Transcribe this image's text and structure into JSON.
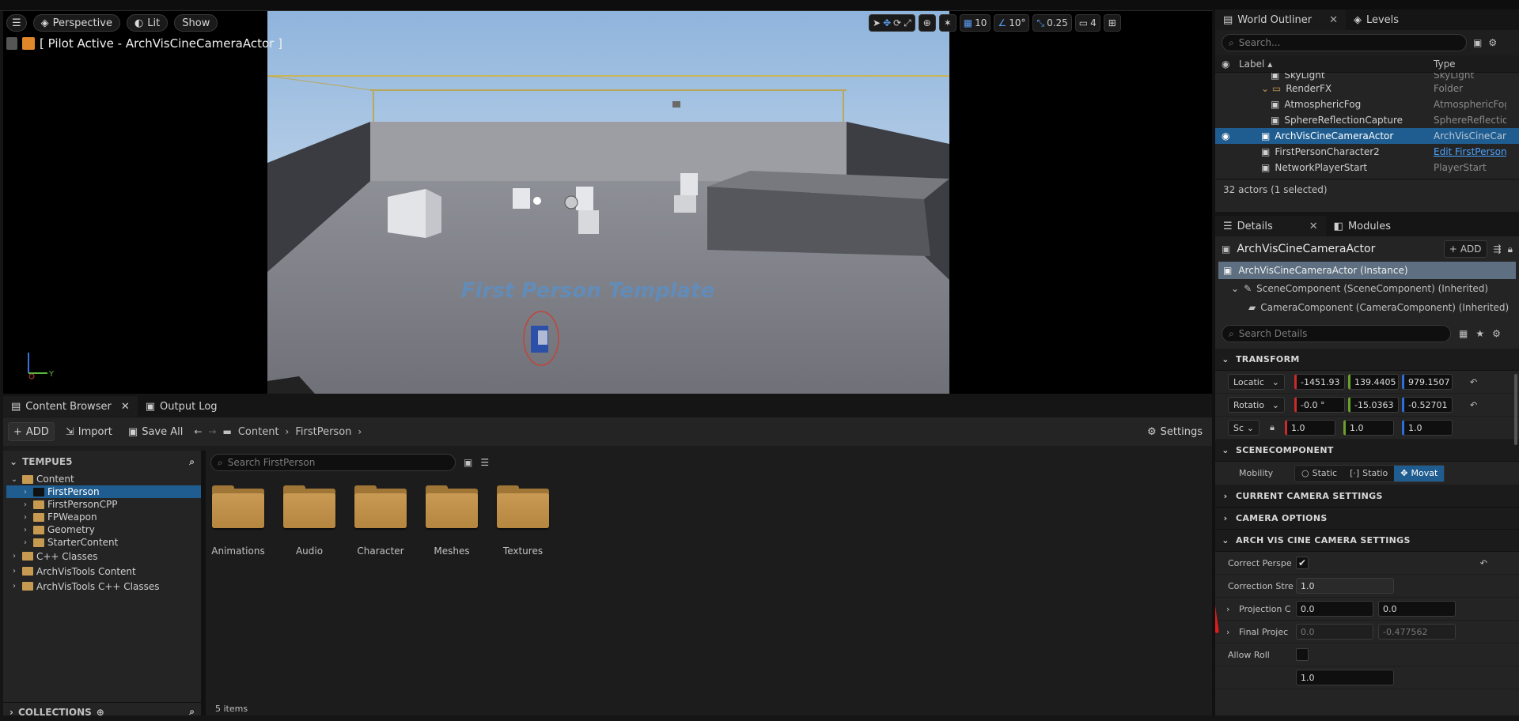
{
  "viewport": {
    "menu_icon": "hamburger-icon",
    "perspective_label": "Perspective",
    "lit_label": "Lit",
    "show_label": "Show",
    "pilot_label": "[ Pilot Active - ArchVisCineCameraActor ]",
    "scene_text": "First Person Template",
    "grid_snap": "10",
    "rotation_snap": "10°",
    "scale_snap": "0.25",
    "camera_speed": "4",
    "axis_labels": {
      "x": "X",
      "y": "Y",
      "z": "Z"
    }
  },
  "outliner": {
    "tab_label": "World Outliner",
    "levels_tab": "Levels",
    "search_placeholder": "Search...",
    "col_label": "Label",
    "col_type": "Type",
    "rows": [
      {
        "label": "SkyLight",
        "type": "SkyLight",
        "indent": 2,
        "partial": true
      },
      {
        "label": "RenderFX",
        "type": "Folder",
        "indent": 1,
        "folder": true
      },
      {
        "label": "AtmosphericFog",
        "type": "AtmosphericFog",
        "indent": 2
      },
      {
        "label": "SphereReflectionCapture",
        "type": "SphereReflectionCapture",
        "indent": 2
      },
      {
        "label": "ArchVisCineCameraActor",
        "type": "ArchVisCineCameraActor",
        "indent": 1,
        "selected": true
      },
      {
        "label": "FirstPersonCharacter2",
        "type": "Edit FirstPersonCharacter",
        "indent": 1,
        "link": true
      },
      {
        "label": "NetworkPlayerStart",
        "type": "PlayerStart",
        "indent": 1
      }
    ],
    "status": "32 actors (1 selected)"
  },
  "details": {
    "tab_label": "Details",
    "modules_tab": "Modules",
    "actor_name": "ArchVisCineCameraActor",
    "add_label": "ADD",
    "instance_label": "ArchVisCineCameraActor (Instance)",
    "components": [
      "SceneComponent (SceneComponent) (Inherited)",
      "CameraComponent (CameraComponent) (Inherited)"
    ],
    "search_placeholder": "Search Details",
    "transform_header": "TRANSFORM",
    "location_label": "Locatic",
    "location": [
      "-1451.93",
      "139.4405",
      "979.1507"
    ],
    "rotation_label": "Rotatio",
    "rotation": [
      "-0.0 °",
      "-15.0363",
      "-0.52701"
    ],
    "scale_label": "Sc",
    "scale": [
      "1.0",
      "1.0",
      "1.0"
    ],
    "scenecomponent_header": "SCENECOMPONENT",
    "mobility_label": "Mobility",
    "mobility_options": [
      "Static",
      "Statio",
      "Movat"
    ],
    "current_camera_header": "CURRENT CAMERA SETTINGS",
    "camera_options_header": "CAMERA OPTIONS",
    "archvis_header": "ARCH VIS CINE CAMERA SETTINGS",
    "correct_perspective_label": "Correct Perspe",
    "correction_strength_label": "Correction Stre",
    "correction_strength": "1.0",
    "projection_label": "Projection C",
    "projection": [
      "0.0",
      "0.0"
    ],
    "final_projection_label": "Final Projec",
    "final_projection": [
      "0.0",
      "-0.477562"
    ],
    "allow_roll_label": "Allow Roll",
    "partial_value": "1.0"
  },
  "content_browser": {
    "tab_label": "Content Browser",
    "output_log_tab": "Output Log",
    "add_label": "ADD",
    "import_label": "Import",
    "save_all_label": "Save All",
    "breadcrumb": [
      "Content",
      "FirstPerson"
    ],
    "settings_label": "Settings",
    "project_label": "TEMPUE5",
    "search_placeholder": "Search FirstPerson",
    "tree": [
      {
        "label": "Content",
        "indent": 0,
        "open": true
      },
      {
        "label": "FirstPerson",
        "indent": 1,
        "selected": true
      },
      {
        "label": "FirstPersonCPP",
        "indent": 1
      },
      {
        "label": "FPWeapon",
        "indent": 1
      },
      {
        "label": "Geometry",
        "indent": 1
      },
      {
        "label": "StarterContent",
        "indent": 1
      }
    ],
    "tree_roots": [
      "C++ Classes",
      "ArchVisTools Content",
      "ArchVisTools C++ Classes"
    ],
    "collections_label": "COLLECTIONS",
    "folders": [
      "Animations",
      "Audio",
      "Character",
      "Meshes",
      "Textures"
    ],
    "item_count": "5 items"
  },
  "colors": {
    "selection": "#1f5c8f",
    "accent_blue": "#2f6ed8",
    "folder": "#c79a52",
    "annotation_red": "#e01b1b"
  }
}
